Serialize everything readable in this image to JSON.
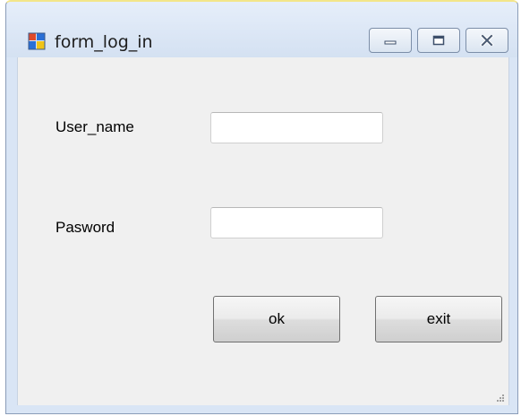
{
  "window": {
    "title": "form_log_in"
  },
  "form": {
    "username_label": "User_name",
    "username_value": "",
    "password_label": "Pasword",
    "password_value": "",
    "ok_label": "ok",
    "exit_label": "exit"
  },
  "icons": {
    "app": "windows-form-icon",
    "minimize": "minimize-icon",
    "maximize": "maximize-icon",
    "close": "close-icon",
    "resize": "resize-grip-icon"
  },
  "colors": {
    "title_bar": "#d9e5f5",
    "client_background": "#f0f0f0",
    "icon_red": "#e04a2a",
    "icon_blue": "#2a6fd6",
    "icon_yellow": "#f0c419"
  }
}
